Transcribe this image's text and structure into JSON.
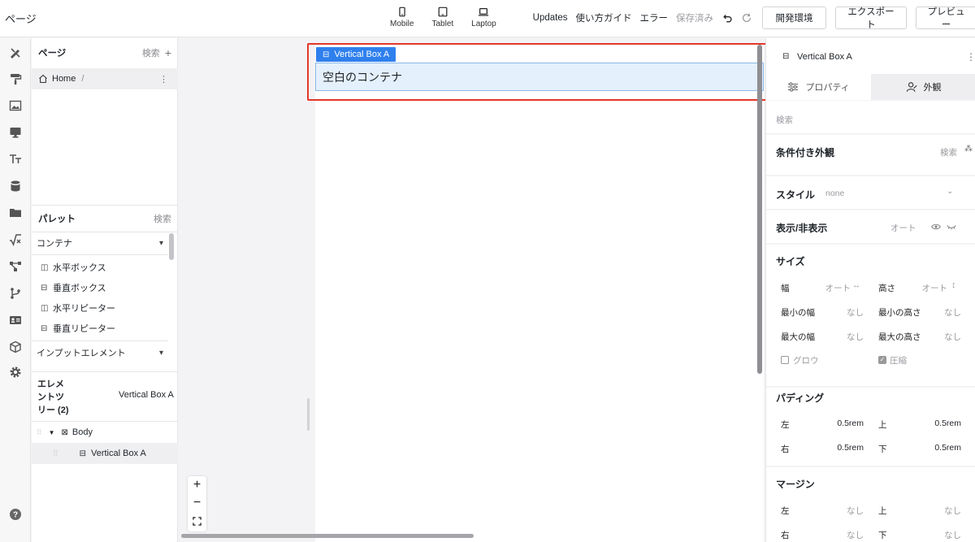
{
  "header": {
    "title": "ページ",
    "devices": [
      {
        "label": "Mobile",
        "icon": "mobile-icon"
      },
      {
        "label": "Tablet",
        "icon": "tablet-icon"
      },
      {
        "label": "Laptop",
        "icon": "laptop-icon"
      }
    ],
    "updates": "Updates",
    "guide": "使い方ガイド",
    "errors": "エラー",
    "saved": "保存済み",
    "dev_env": "開発環境",
    "export": "エクスポート",
    "preview": "プレビュー"
  },
  "pages_panel": {
    "title": "ページ",
    "search": "検索",
    "home": "Home",
    "home_path": "/"
  },
  "palette": {
    "title": "パレット",
    "search": "検索",
    "container_category": "コンテナ",
    "items": [
      "水平ボックス",
      "垂直ボックス",
      "水平リピーター",
      "垂直リピーター"
    ],
    "input_category": "インプットエレメント"
  },
  "element_tree": {
    "title": "エレメントツリー (2)",
    "selected_name": "Vertical Box A",
    "rows": [
      "Body",
      "Vertical Box A"
    ]
  },
  "canvas": {
    "frame_label": "Vertical Box A",
    "box_text": "空白のコンテナ"
  },
  "inspector": {
    "element_name": "Vertical Box A",
    "tab_properties": "プロパティ",
    "tab_appearance": "外観",
    "search": "検索",
    "conditional_title": "条件付き外観",
    "conditional_search": "検索",
    "style_title": "スタイル",
    "style_value": "none",
    "visibility_title": "表示/非表示",
    "visibility_value": "オート",
    "size_title": "サイズ",
    "width_label": "幅",
    "width_value": "オート",
    "height_label": "高さ",
    "height_value": "オート",
    "min_width_label": "最小の幅",
    "min_width_value": "なし",
    "min_height_label": "最小の高さ",
    "min_height_value": "なし",
    "max_width_label": "最大の幅",
    "max_width_value": "なし",
    "max_height_label": "最大の高さ",
    "max_height_value": "なし",
    "grow_label": "グロウ",
    "shrink_label": "圧縮",
    "padding_title": "パディング",
    "left_label": "左",
    "top_label": "上",
    "right_label": "右",
    "bottom_label": "下",
    "padding_left": "0.5rem",
    "padding_top": "0.5rem",
    "padding_right": "0.5rem",
    "padding_bottom": "0.5rem",
    "margin_title": "マージン",
    "margin_left": "なし",
    "margin_top": "なし",
    "margin_right": "なし",
    "margin_bottom": "なし"
  },
  "colors": {
    "accent": "#2f80ed",
    "selection_fill": "#e4f0fc",
    "annotation": "#e3372b"
  }
}
